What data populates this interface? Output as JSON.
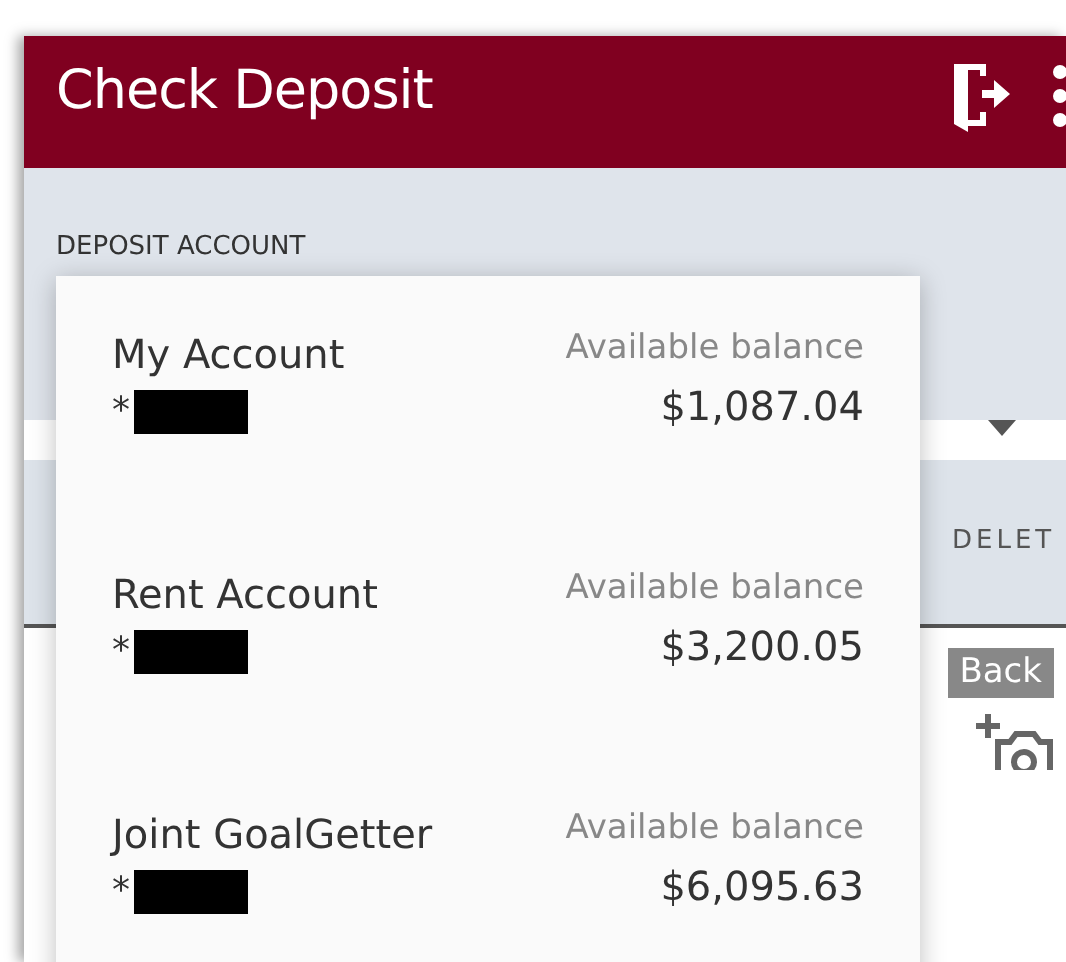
{
  "header": {
    "title": "Check Deposit"
  },
  "deposit_account": {
    "label": "DEPOSIT ACCOUNT"
  },
  "accounts": [
    {
      "name": "My Account",
      "mask": "*",
      "balance_label": "Available balance",
      "balance": "$1,087.04"
    },
    {
      "name": "Rent Account",
      "mask": "*",
      "balance_label": "Available balance",
      "balance": "$3,200.05"
    },
    {
      "name": "Joint GoalGetter",
      "mask": "*",
      "balance_label": "Available balance",
      "balance": "$6,095.63"
    }
  ],
  "toolbar": {
    "delete": "DELET",
    "back": "Back"
  }
}
